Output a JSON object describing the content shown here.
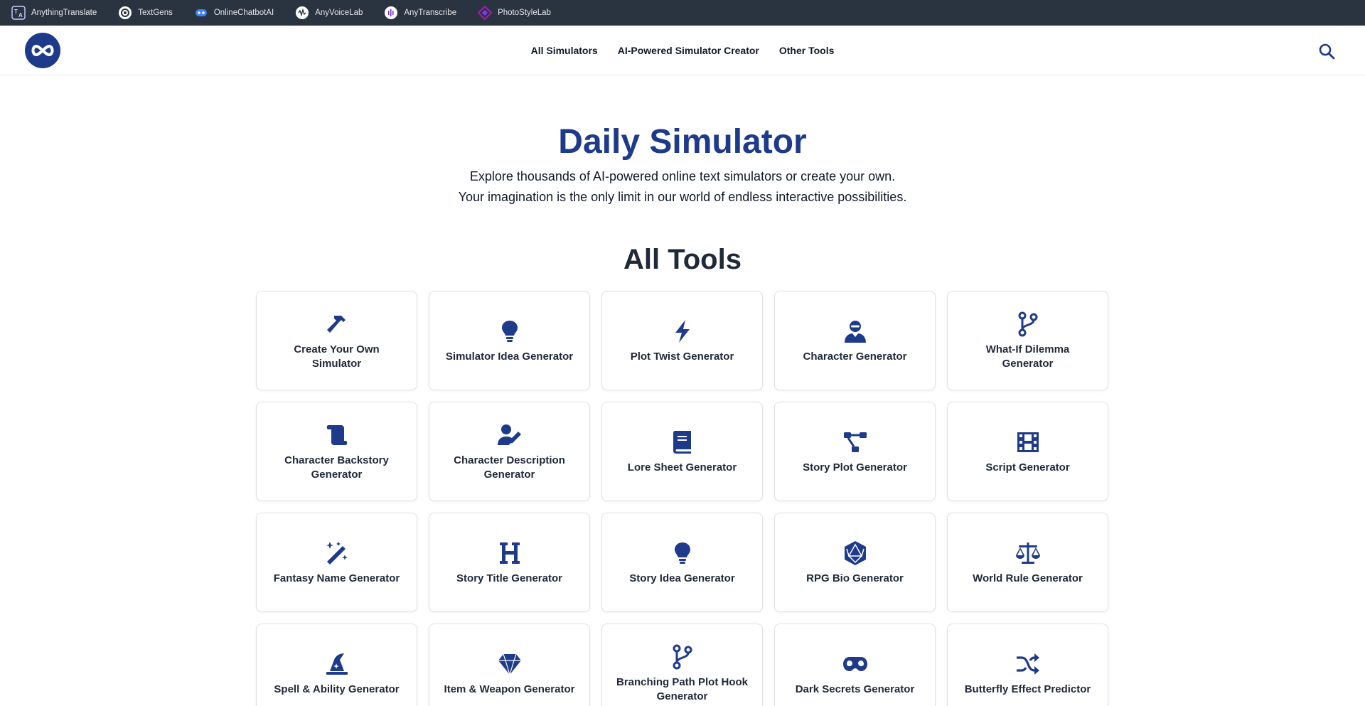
{
  "topbar": {
    "items": [
      {
        "label": "AnythingTranslate",
        "icon": "translate-icon"
      },
      {
        "label": "TextGens",
        "icon": "textgens-icon"
      },
      {
        "label": "OnlineChatbotAI",
        "icon": "chatbot-icon"
      },
      {
        "label": "AnyVoiceLab",
        "icon": "voicelab-icon"
      },
      {
        "label": "AnyTranscribe",
        "icon": "transcribe-icon"
      },
      {
        "label": "PhotoStyleLab",
        "icon": "photostyle-icon"
      }
    ]
  },
  "header": {
    "logo_icon": "infinity-logo-icon",
    "nav": [
      "All Simulators",
      "AI-Powered Simulator Creator",
      "Other Tools"
    ],
    "search_icon": "search-icon"
  },
  "hero": {
    "title": "Daily Simulator",
    "line1": "Explore thousands of AI-powered online text simulators or create your own.",
    "line2": "Your imagination is the only limit in our world of endless interactive possibilities."
  },
  "tools": {
    "heading": "All Tools",
    "items": [
      {
        "label": "Create Your Own Simulator",
        "icon": "hammer-icon"
      },
      {
        "label": "Simulator Idea Generator",
        "icon": "lightbulb-icon"
      },
      {
        "label": "Plot Twist Generator",
        "icon": "bolt-icon"
      },
      {
        "label": "Character Generator",
        "icon": "user-ninja-icon"
      },
      {
        "label": "What-If Dilemma Generator",
        "icon": "code-branch-icon"
      },
      {
        "label": "Character Backstory Generator",
        "icon": "scroll-icon"
      },
      {
        "label": "Character Description Generator",
        "icon": "user-pen-icon"
      },
      {
        "label": "Lore Sheet Generator",
        "icon": "book-icon"
      },
      {
        "label": "Story Plot Generator",
        "icon": "diagram-icon"
      },
      {
        "label": "Script Generator",
        "icon": "film-icon"
      },
      {
        "label": "Fantasy Name Generator",
        "icon": "magic-wand-icon"
      },
      {
        "label": "Story Title Generator",
        "icon": "heading-icon"
      },
      {
        "label": "Story Idea Generator",
        "icon": "lightbulb-icon"
      },
      {
        "label": "RPG Bio Generator",
        "icon": "d20-dice-icon"
      },
      {
        "label": "World Rule Generator",
        "icon": "scale-balanced-icon"
      },
      {
        "label": "Spell & Ability Generator",
        "icon": "hat-wizard-icon"
      },
      {
        "label": "Item & Weapon Generator",
        "icon": "gem-icon"
      },
      {
        "label": "Branching Path Plot Hook Generator",
        "icon": "code-branch-icon"
      },
      {
        "label": "Dark Secrets Generator",
        "icon": "mask-icon"
      },
      {
        "label": "Butterfly Effect Predictor",
        "icon": "shuffle-icon"
      }
    ]
  },
  "colors": {
    "accent": "#1e3a8a",
    "topbar_bg": "#2a3441",
    "icon_fill": "#1e3a8a"
  }
}
